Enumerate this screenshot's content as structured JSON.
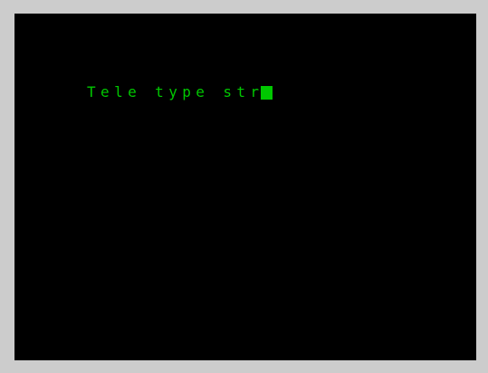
{
  "terminal": {
    "text": "Tele type str",
    "text_color": "#00c800",
    "background_color": "#000000",
    "border_color": "#cccccc",
    "cursor": "block-cursor"
  }
}
